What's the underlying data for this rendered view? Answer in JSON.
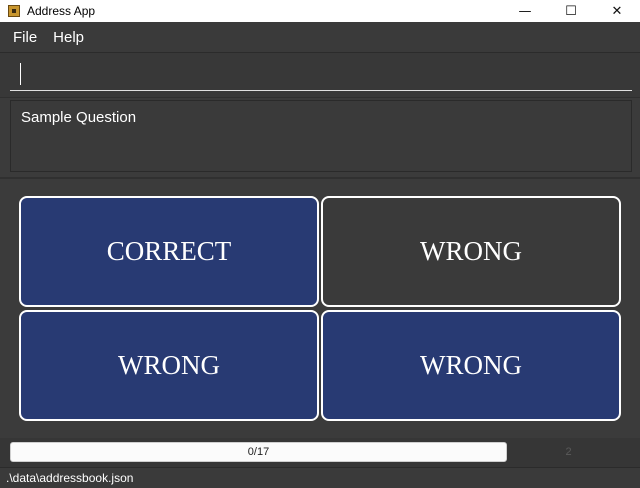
{
  "window": {
    "title": "Address App",
    "icon": "app-icon",
    "controls": {
      "minimize": "—",
      "maximize": "☐",
      "close": "✕"
    }
  },
  "menu": {
    "items": [
      {
        "label": "File"
      },
      {
        "label": "Help"
      }
    ]
  },
  "command": {
    "value": "",
    "placeholder": ""
  },
  "question": {
    "text": "Sample Question"
  },
  "options": [
    {
      "label": "CORRECT",
      "color": "#283a73"
    },
    {
      "label": "WRONG",
      "color": "#3a3a3a"
    },
    {
      "label": "WRONG",
      "color": "#283a73"
    },
    {
      "label": "WRONG",
      "color": "#283a73"
    }
  ],
  "progress": {
    "label": "0/17",
    "fraction": 0,
    "score": "2"
  },
  "status": {
    "path": ".\\data\\addressbook.json"
  },
  "colors": {
    "accent_blue": "#283a73",
    "background": "#3b3b3b",
    "border": "#ffffff"
  }
}
